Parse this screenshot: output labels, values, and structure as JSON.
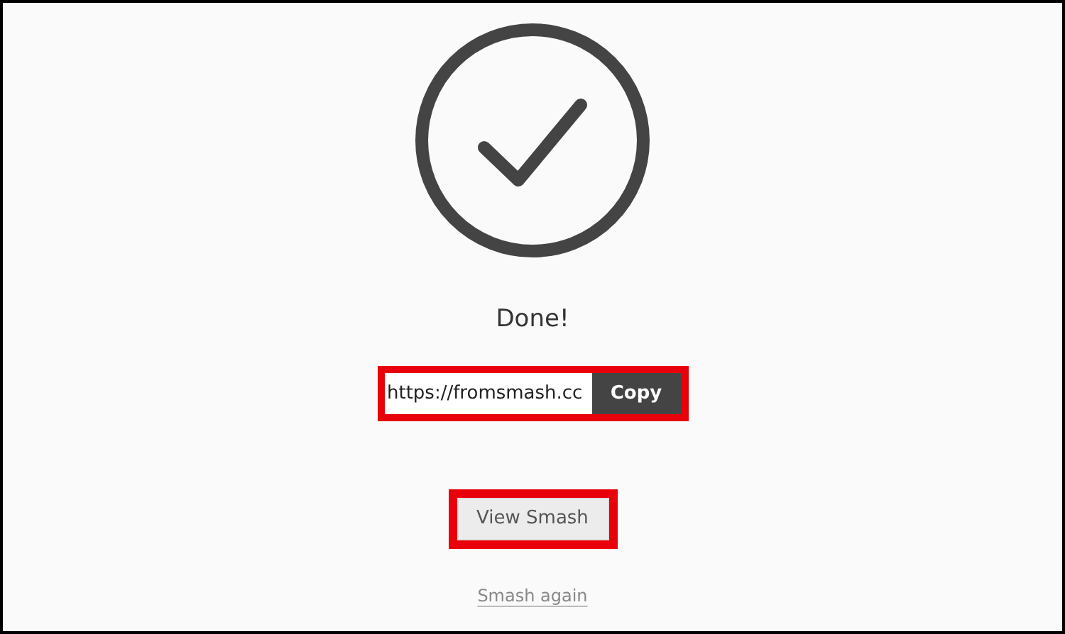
{
  "status": {
    "title": "Done!"
  },
  "share": {
    "link": "https://fromsmash.cc",
    "copy_button": "Copy",
    "highlighted": true
  },
  "view_button": {
    "label": "View Smash",
    "highlighted": true
  },
  "again_link": "Smash again"
}
